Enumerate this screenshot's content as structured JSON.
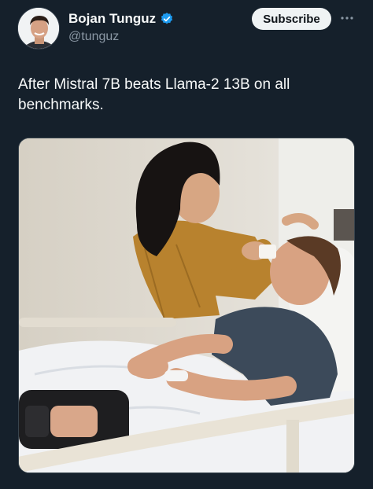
{
  "author": {
    "name": "Bojan Tunguz",
    "handle": "@tunguz",
    "verified": true
  },
  "actions": {
    "subscribe_label": "Subscribe",
    "more_icon": "more-horizontal-icon"
  },
  "tweet": {
    "text": "After Mistral 7B beats Llama-2 13B on all benchmarks."
  },
  "colors": {
    "background": "#15202b",
    "text_primary": "#f7f9f9",
    "text_secondary": "#8b98a5",
    "verified_badge": "#1d9bf0",
    "subscribe_bg": "#eff3f4"
  }
}
